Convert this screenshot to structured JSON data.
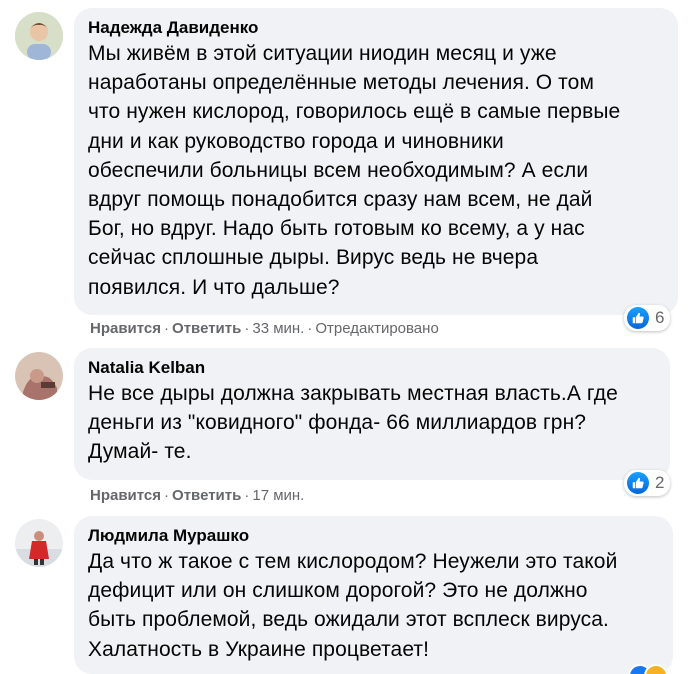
{
  "comments": [
    {
      "author": "Надежда Давиденко",
      "text": "Мы живём в этой ситуации ниодин месяц и уже\nнаработаны определённые методы лечения. О том\nчто нужен кислород, говорилось ещё в самые первые\nдни и как руководство города и чиновники\nобеспечили больницы всем необходимым? А если\nвдруг помощь понадобится сразу нам всем, не дай\nБог, но вдруг. Надо быть готовым ко всему, а у нас\nсейчас сплошные дыры. Вирус ведь не вчера\nпоявился. И что дальше?",
      "like_label": "Нравится",
      "reply_label": "Ответить",
      "time": "33 мин.",
      "edited": "Отредактировано",
      "reaction_count": "6"
    },
    {
      "author": "Natalia Kelban",
      "text": "Не все дыры должна закрывать местная власть.А где\nденьги из \"ковидного\" фонда- 66 миллиардов грн?\nДумай- те.",
      "like_label": "Нравится",
      "reply_label": "Ответить",
      "time": "17 мин.",
      "reaction_count": "2"
    },
    {
      "author": "Людмила Мурашко",
      "text": "Да что ж такое с тем кислородом? Неужели это такой\nдефицит или он слишком дорогой? Это не должно\nбыть проблемой, ведь ожидали этот всплеск вируса.\nХалатность в Украине процветает!"
    }
  ],
  "colors": {
    "bubble": "#f0f2f5",
    "meta": "#65676b",
    "like_blue": "#1877f2"
  }
}
